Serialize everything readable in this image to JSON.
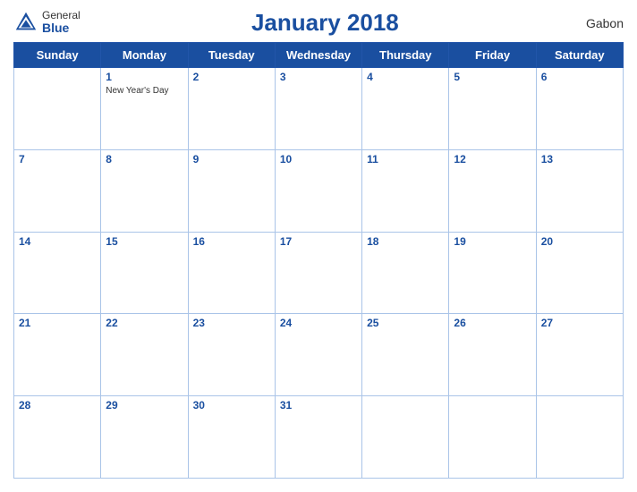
{
  "header": {
    "title": "January 2018",
    "country": "Gabon",
    "logo": {
      "general": "General",
      "blue": "Blue"
    }
  },
  "days_of_week": [
    "Sunday",
    "Monday",
    "Tuesday",
    "Wednesday",
    "Thursday",
    "Friday",
    "Saturday"
  ],
  "weeks": [
    [
      {
        "day": "",
        "empty": true
      },
      {
        "day": "1",
        "holiday": "New Year's Day"
      },
      {
        "day": "2",
        "holiday": ""
      },
      {
        "day": "3",
        "holiday": ""
      },
      {
        "day": "4",
        "holiday": ""
      },
      {
        "day": "5",
        "holiday": ""
      },
      {
        "day": "6",
        "holiday": ""
      }
    ],
    [
      {
        "day": "7",
        "holiday": ""
      },
      {
        "day": "8",
        "holiday": ""
      },
      {
        "day": "9",
        "holiday": ""
      },
      {
        "day": "10",
        "holiday": ""
      },
      {
        "day": "11",
        "holiday": ""
      },
      {
        "day": "12",
        "holiday": ""
      },
      {
        "day": "13",
        "holiday": ""
      }
    ],
    [
      {
        "day": "14",
        "holiday": ""
      },
      {
        "day": "15",
        "holiday": ""
      },
      {
        "day": "16",
        "holiday": ""
      },
      {
        "day": "17",
        "holiday": ""
      },
      {
        "day": "18",
        "holiday": ""
      },
      {
        "day": "19",
        "holiday": ""
      },
      {
        "day": "20",
        "holiday": ""
      }
    ],
    [
      {
        "day": "21",
        "holiday": ""
      },
      {
        "day": "22",
        "holiday": ""
      },
      {
        "day": "23",
        "holiday": ""
      },
      {
        "day": "24",
        "holiday": ""
      },
      {
        "day": "25",
        "holiday": ""
      },
      {
        "day": "26",
        "holiday": ""
      },
      {
        "day": "27",
        "holiday": ""
      }
    ],
    [
      {
        "day": "28",
        "holiday": ""
      },
      {
        "day": "29",
        "holiday": ""
      },
      {
        "day": "30",
        "holiday": ""
      },
      {
        "day": "31",
        "holiday": ""
      },
      {
        "day": "",
        "empty": true
      },
      {
        "day": "",
        "empty": true
      },
      {
        "day": "",
        "empty": true
      }
    ]
  ]
}
